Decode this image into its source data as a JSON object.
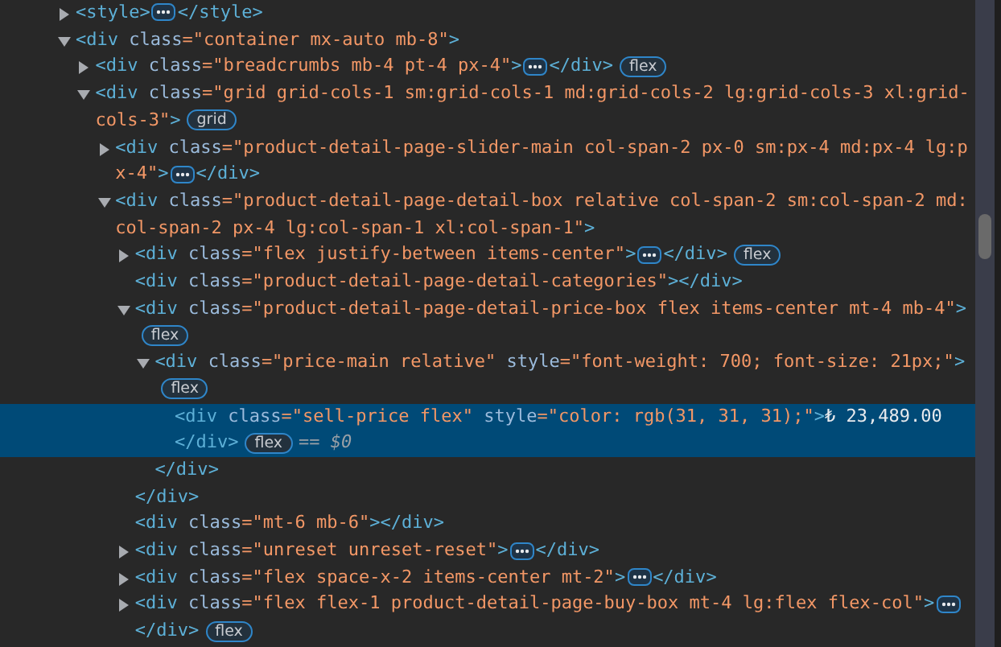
{
  "dom_tree": [
    {
      "open_tag": "<style>",
      "expanded": false,
      "selected": false,
      "closing_tag": "</style>"
    },
    {
      "open_tag": "<div class=\"container mx-auto mb-8\">",
      "expanded": true,
      "selected": false,
      "children": [
        {
          "open_tag": "<div class=\"breadcrumbs mb-4 pt-4 px-4\">",
          "expanded": false,
          "selected": false,
          "closing_tag": "</div>",
          "badge": "flex"
        },
        {
          "open_tag": "<div class=\"grid grid-cols-1 sm:grid-cols-1 md:grid-cols-2 lg:grid-cols-3 xl:grid-cols-3\">",
          "expanded": true,
          "selected": false,
          "badge": "grid",
          "children": [
            {
              "open_tag": "<div class=\"product-detail-page-slider-main col-span-2 px-0 sm:px-4 md:px-4 lg:px-4\">",
              "expanded": false,
              "selected": false,
              "closing_tag": "</div>"
            },
            {
              "open_tag": "<div class=\"product-detail-page-detail-box relative col-span-2 sm:col-span-2 md:col-span-2 px-4 lg:col-span-1 xl:col-span-1\">",
              "expanded": true,
              "selected": false,
              "children": [
                {
                  "open_tag": "<div class=\"flex justify-between items-center\">",
                  "expanded": false,
                  "selected": false,
                  "closing_tag": "</div>",
                  "badge": "flex"
                },
                {
                  "open_tag": "<div class=\"product-detail-page-detail-categories\">",
                  "selected": false,
                  "closing_tag": "</div>"
                },
                {
                  "open_tag": "<div class=\"product-detail-page-detail-price-box flex items-center mt-4 mb-4\">",
                  "expanded": true,
                  "selected": false,
                  "badge": "flex",
                  "closing_tag": "</div>",
                  "children": [
                    {
                      "open_tag": "<div class=\"price-main relative\" style=\"font-weight: 700; font-size: 21px;\">",
                      "expanded": true,
                      "selected": false,
                      "badge": "flex",
                      "closing_tag": "</div>",
                      "children": [
                        {
                          "open_tag": "<div class=\"sell-price flex\" style=\"color: rgb(31, 31, 31);\">",
                          "selected": true,
                          "content": "₺ 23,489.00",
                          "closing_tag": "</div>",
                          "badge": "flex",
                          "reference": "== *$0*"
                        }
                      ]
                    }
                  ]
                },
                {
                  "open_tag": "<div class=\"mt-6 mb-6\">",
                  "selected": false,
                  "closing_tag": "</div>"
                },
                {
                  "open_tag": "<div class=\"unreset unreset-reset\">",
                  "expanded": false,
                  "selected": false,
                  "closing_tag": "</div>"
                },
                {
                  "open_tag": "<div class=\"flex space-x-2 items-center mt-2\">",
                  "expanded": false,
                  "selected": false,
                  "closing_tag": "</div>"
                },
                {
                  "open_tag": "<div class=\"flex flex-1 product-detail-page-buy-box mt-4 lg:flex flex-col\">",
                  "expanded": false,
                  "selected": false,
                  "closing_tag": "</div>",
                  "badge": "flex"
                }
              ]
            }
          ]
        }
      ]
    }
  ]
}
